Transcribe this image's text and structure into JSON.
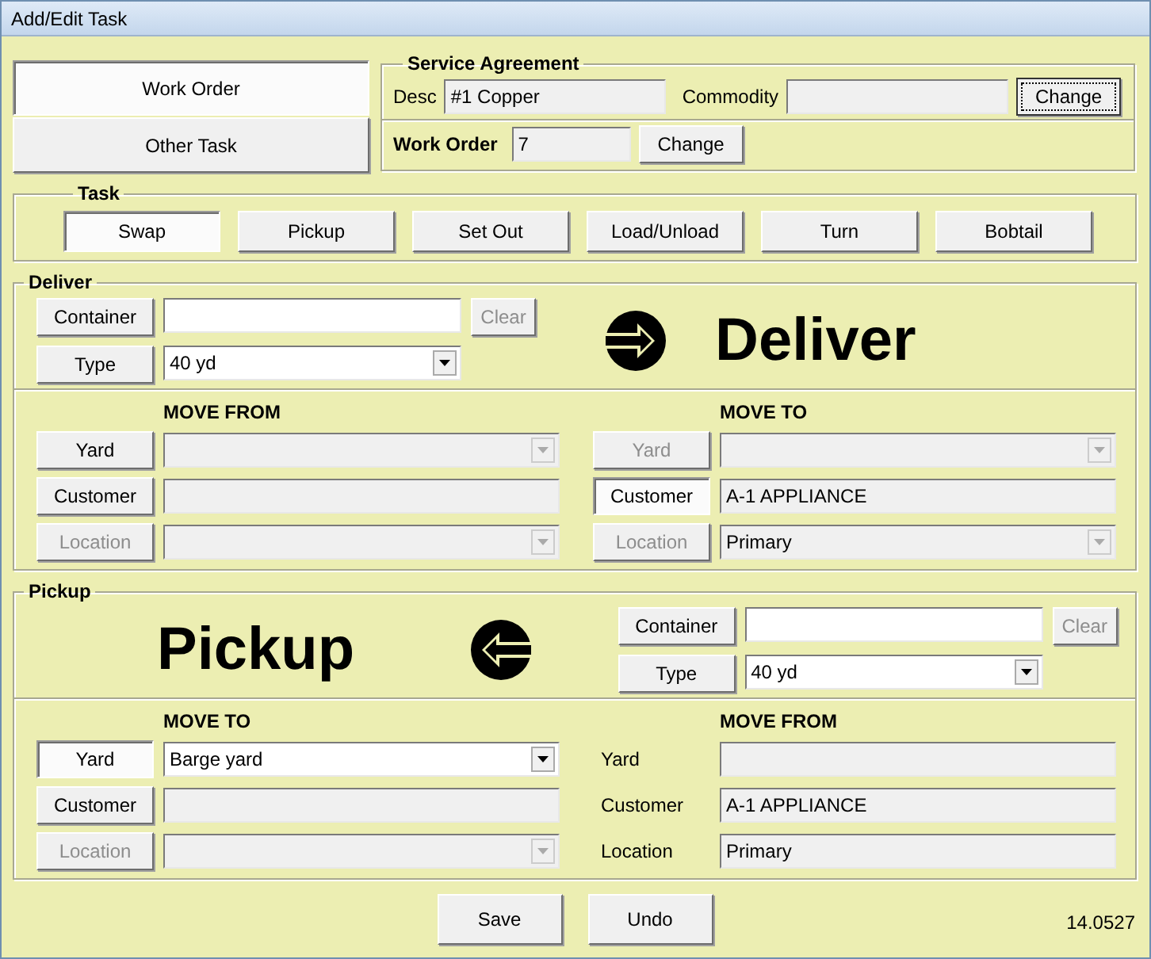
{
  "window": {
    "title": "Add/Edit Task"
  },
  "mode_buttons": [
    {
      "label": "Work Order",
      "selected": true
    },
    {
      "label": "Other Task",
      "selected": false
    }
  ],
  "service_agreement": {
    "title": "Service Agreement",
    "desc_label": "Desc",
    "desc": "#1 Copper",
    "commodity_label": "Commodity",
    "change": {
      "label": "Change",
      "focused": true
    }
  },
  "work_order": {
    "label": "Work Order",
    "value": "7",
    "change": {
      "label": "Change",
      "focused": false
    }
  },
  "task": {
    "title": "Task",
    "buttons": [
      {
        "label": "Swap",
        "selected": true
      },
      {
        "label": "Pickup",
        "selected": false
      },
      {
        "label": "Set Out",
        "selected": false
      },
      {
        "label": "Load/Unload",
        "selected": false
      },
      {
        "label": "Turn",
        "selected": false
      },
      {
        "label": "Bobtail",
        "selected": false
      }
    ]
  },
  "sections": [
    {
      "kind": "deliver",
      "title": "Deliver",
      "banner": "Deliver",
      "container_button": "Container",
      "clear_button": {
        "label": "Clear",
        "disabled": true
      },
      "type_button": "Type",
      "type_value": "40 yd",
      "columns": [
        {
          "heading": "MOVE FROM",
          "rows": [
            {
              "kind": "button",
              "label": "Yard",
              "disabled": false,
              "selected": false,
              "field": {
                "kind": "dropdown",
                "editable": false
              }
            },
            {
              "kind": "button",
              "label": "Customer",
              "disabled": false,
              "selected": false,
              "field": {
                "kind": "text",
                "editable": false
              }
            },
            {
              "kind": "button",
              "label": "Location",
              "disabled": true,
              "selected": false,
              "field": {
                "kind": "dropdown",
                "editable": false
              }
            }
          ]
        },
        {
          "heading": "MOVE TO",
          "rows": [
            {
              "kind": "button",
              "label": "Yard",
              "disabled": true,
              "selected": false,
              "field": {
                "kind": "dropdown",
                "editable": false
              }
            },
            {
              "kind": "button",
              "label": "Customer",
              "disabled": false,
              "selected": true,
              "field": {
                "kind": "text",
                "editable": false,
                "value": "A-1 APPLIANCE"
              }
            },
            {
              "kind": "button",
              "label": "Location",
              "disabled": true,
              "selected": false,
              "field": {
                "kind": "dropdown",
                "editable": false,
                "value": "Primary"
              }
            }
          ]
        }
      ]
    },
    {
      "kind": "pickup",
      "title": "Pickup",
      "banner": "Pickup",
      "container_button": "Container",
      "clear_button": {
        "label": "Clear",
        "disabled": true
      },
      "type_button": "Type",
      "type_value": "40 yd",
      "columns": [
        {
          "heading": "MOVE TO",
          "rows": [
            {
              "kind": "button",
              "label": "Yard",
              "disabled": false,
              "selected": true,
              "field": {
                "kind": "dropdown",
                "editable": true,
                "value": "Barge yard"
              }
            },
            {
              "kind": "button",
              "label": "Customer",
              "disabled": false,
              "selected": false,
              "field": {
                "kind": "text",
                "editable": false
              }
            },
            {
              "kind": "button",
              "label": "Location",
              "disabled": true,
              "selected": false,
              "field": {
                "kind": "dropdown",
                "editable": false
              }
            }
          ]
        },
        {
          "heading": "MOVE FROM",
          "rows": [
            {
              "kind": "label",
              "label": "Yard",
              "field": {
                "kind": "text",
                "editable": false
              }
            },
            {
              "kind": "label",
              "label": "Customer",
              "field": {
                "kind": "text",
                "editable": false,
                "value": "A-1 APPLIANCE"
              }
            },
            {
              "kind": "label",
              "label": "Location",
              "field": {
                "kind": "text",
                "editable": false,
                "value": "Primary"
              }
            }
          ]
        }
      ]
    }
  ],
  "footer": {
    "buttons": [
      "Save",
      "Undo"
    ],
    "version": "14.0527"
  }
}
